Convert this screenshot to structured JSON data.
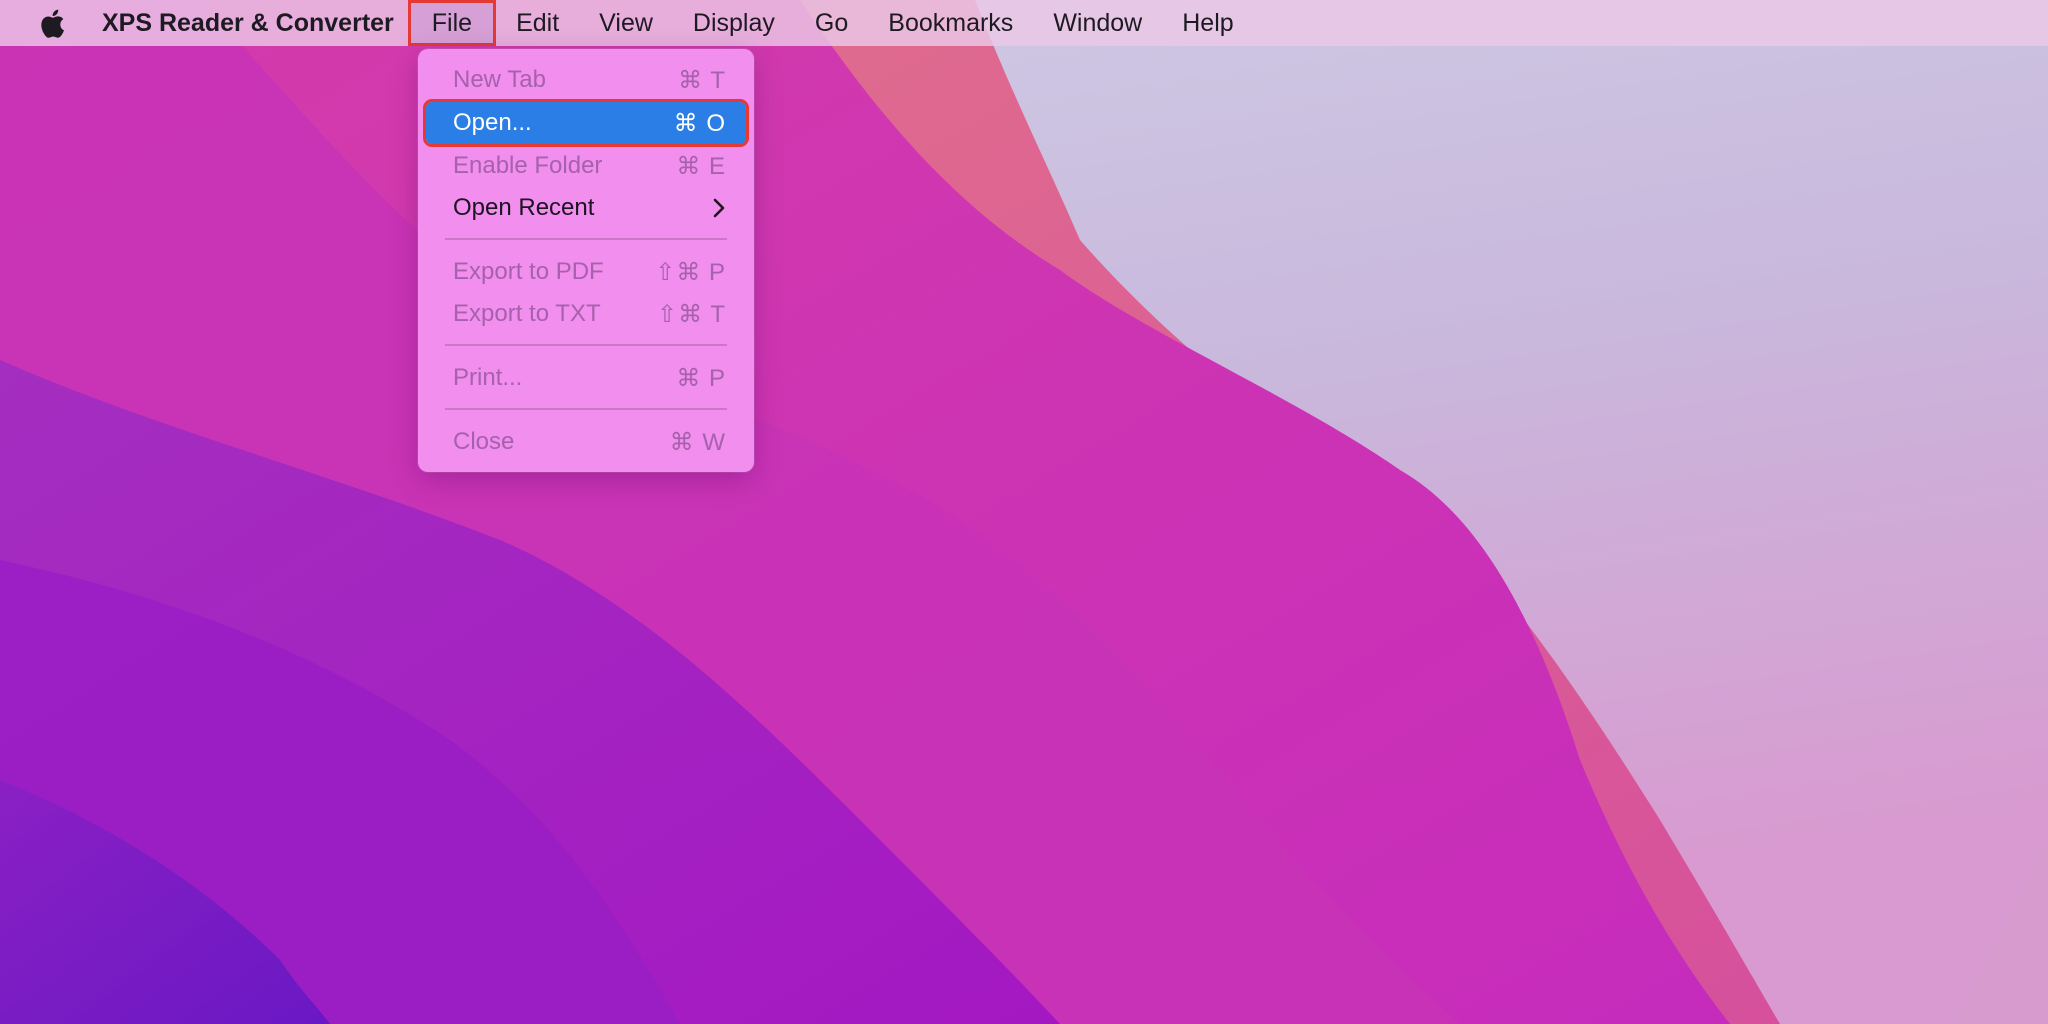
{
  "menubar": {
    "apple_icon": "apple-logo-icon",
    "app_name": "XPS Reader & Converter",
    "menus": [
      "File",
      "Edit",
      "View",
      "Display",
      "Go",
      "Bookmarks",
      "Window",
      "Help"
    ],
    "active_menu": "File"
  },
  "file_menu": {
    "items": [
      {
        "label": "New Tab",
        "shortcut": "⌘ T",
        "enabled": false
      },
      {
        "label": "Open...",
        "shortcut": "⌘ O",
        "enabled": true,
        "highlighted": true
      },
      {
        "label": "Enable Folder",
        "shortcut": "⌘ E",
        "enabled": false
      },
      {
        "label": "Open Recent",
        "submenu_icon": "chevron-right-icon",
        "enabled": true
      },
      {
        "label": "Export to PDF",
        "shortcut": "⇧⌘ P",
        "enabled": false
      },
      {
        "label": "Export to TXT",
        "shortcut": "⇧⌘ T",
        "enabled": false
      },
      {
        "label": "Print...",
        "shortcut": "⌘ P",
        "enabled": false
      },
      {
        "label": "Close",
        "shortcut": "⌘ W",
        "enabled": false
      }
    ]
  },
  "colors": {
    "highlight": "#2a7ee6",
    "annotation_box": "#e53935",
    "menu_background": "#f292f0"
  }
}
